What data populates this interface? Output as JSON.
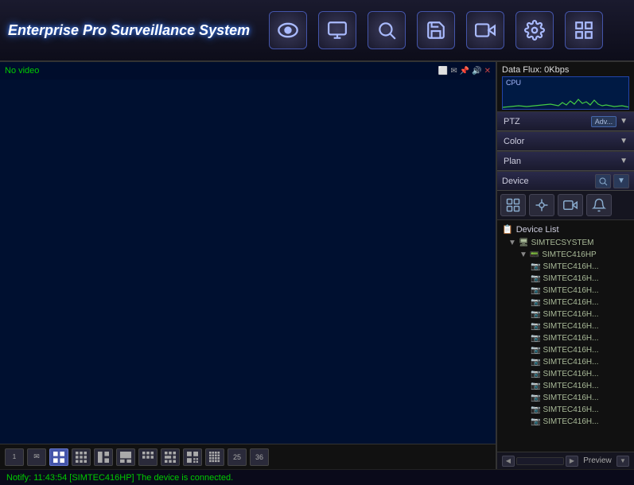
{
  "app": {
    "title": "Enterprise Pro Surveillance System"
  },
  "toolbar": {
    "buttons": [
      {
        "id": "eye",
        "label": "👁",
        "unicode": "👁"
      },
      {
        "id": "camera",
        "label": "📷",
        "unicode": "📷"
      },
      {
        "id": "search",
        "label": "🔍",
        "unicode": "🔍"
      },
      {
        "id": "save",
        "label": "💾",
        "unicode": "💾"
      },
      {
        "id": "record",
        "label": "⏺",
        "unicode": "⏺"
      },
      {
        "id": "settings",
        "label": "⚙",
        "unicode": "⚙"
      },
      {
        "id": "grid",
        "label": "▦",
        "unicode": "▦"
      }
    ]
  },
  "video": {
    "status": "No video",
    "icons_bar": "⬜ ✉ 📌 🔊 ✕"
  },
  "right_panel": {
    "data_flux": {
      "title": "Data Flux: 0Kbps",
      "cpu_label": "CPU"
    },
    "ptz": {
      "title": "PTZ",
      "adv": "Adv..."
    },
    "color": {
      "title": "Color"
    },
    "plan": {
      "title": "Plan"
    },
    "device": {
      "title": "Device"
    }
  },
  "device_tree": {
    "header": "Device List",
    "items": [
      {
        "id": "system",
        "label": "SIMTECSYSTEM",
        "indent": 1,
        "type": "system"
      },
      {
        "id": "dvr",
        "label": "SIMTEC416HP",
        "indent": 2,
        "type": "dvr"
      },
      {
        "id": "ch1",
        "label": "SIMTEC416H...",
        "indent": 3,
        "type": "camera"
      },
      {
        "id": "ch2",
        "label": "SIMTEC416H...",
        "indent": 3,
        "type": "camera"
      },
      {
        "id": "ch3",
        "label": "SIMTEC416H...",
        "indent": 3,
        "type": "camera"
      },
      {
        "id": "ch4",
        "label": "SIMTEC416H...",
        "indent": 3,
        "type": "camera"
      },
      {
        "id": "ch5",
        "label": "SIMTEC416H...",
        "indent": 3,
        "type": "camera"
      },
      {
        "id": "ch6",
        "label": "SIMTEC416H...",
        "indent": 3,
        "type": "camera"
      },
      {
        "id": "ch7",
        "label": "SIMTEC416H...",
        "indent": 3,
        "type": "camera"
      },
      {
        "id": "ch8",
        "label": "SIMTEC416H...",
        "indent": 3,
        "type": "camera"
      },
      {
        "id": "ch9",
        "label": "SIMTEC416H...",
        "indent": 3,
        "type": "camera"
      },
      {
        "id": "ch10",
        "label": "SIMTEC416H...",
        "indent": 3,
        "type": "camera"
      },
      {
        "id": "ch11",
        "label": "SIMTEC416H...",
        "indent": 3,
        "type": "camera"
      },
      {
        "id": "ch12",
        "label": "SIMTEC416H...",
        "indent": 3,
        "type": "camera"
      },
      {
        "id": "ch13",
        "label": "SIMTEC416H...",
        "indent": 3,
        "type": "camera"
      },
      {
        "id": "ch14",
        "label": "SIMTEC416H...",
        "indent": 3,
        "type": "camera"
      }
    ]
  },
  "preview": {
    "label": "Preview"
  },
  "notify": {
    "text": "Notify:  11:43:54  [SIMTEC416HP] The device is connected."
  },
  "view_buttons": [
    {
      "id": "1x1",
      "label": "1"
    },
    {
      "id": "2x2",
      "label": "✉"
    },
    {
      "id": "3x3",
      "label": "⊞",
      "active": true
    },
    {
      "id": "4x4",
      "label": "⊞"
    },
    {
      "id": "v5",
      "label": "⊟"
    },
    {
      "id": "v6",
      "label": "⊡"
    },
    {
      "id": "v7",
      "label": "▦"
    },
    {
      "id": "v8",
      "label": "⊞"
    },
    {
      "id": "v9",
      "label": "⊟"
    },
    {
      "id": "v10",
      "label": "▩"
    },
    {
      "id": "v11",
      "label": "25"
    },
    {
      "id": "v12",
      "label": "36"
    }
  ]
}
